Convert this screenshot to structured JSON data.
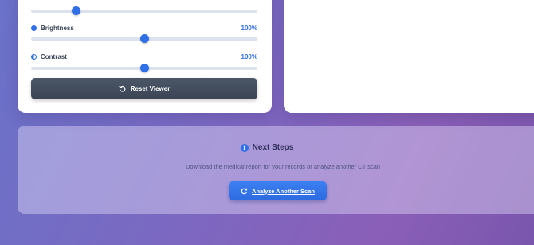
{
  "viewer": {
    "brightness_label": "Brightness",
    "brightness_value": "100%",
    "contrast_label": "Contrast",
    "contrast_value": "100%",
    "reset_label": "Reset Viewer",
    "sliders": {
      "top_level": 0.2,
      "brightness_level": 0.5,
      "contrast_level": 0.5
    }
  },
  "next_steps": {
    "title": "Next Steps",
    "description": "Download the medical report for your records or analyze another CT scan",
    "button_label": "Analyze Another Scan"
  },
  "icons": {
    "brightness": "brightness-icon",
    "contrast": "contrast-icon",
    "reset": "reset-icon",
    "info": "info-icon",
    "refresh": "refresh-icon"
  },
  "colors": {
    "accent": "#2f6fe8",
    "reset_button": "#3f4959"
  }
}
